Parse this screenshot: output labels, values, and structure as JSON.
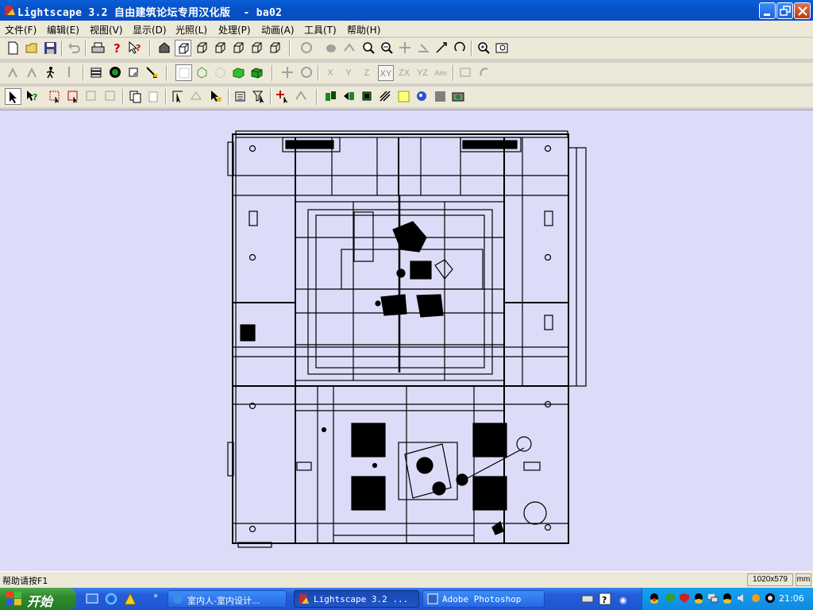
{
  "window": {
    "title": "Lightscape 3.2 自由建筑论坛专用汉化版  - ba02",
    "buttons": [
      "minimize",
      "restore",
      "close"
    ]
  },
  "menu": {
    "items": [
      "文件(F)",
      "编辑(E)",
      "视图(V)",
      "显示(D)",
      "光照(L)",
      "处理(P)",
      "动画(A)",
      "工具(T)",
      "帮助(H)"
    ]
  },
  "toolbar": {
    "axis_labels": [
      "X",
      "Y",
      "Z",
      "XY",
      "ZX",
      "YZ",
      "Aim"
    ]
  },
  "status": {
    "help_text": "帮助请按F1",
    "resolution": "1020x579",
    "units": "mm"
  },
  "taskbar": {
    "start_label": "开始",
    "tasks": [
      {
        "label": "室内人-室内设计..."
      },
      {
        "label": "Lightscape 3.2 ..."
      },
      {
        "label": "Adobe Photoshop"
      }
    ],
    "clock": "21:06"
  },
  "colors": {
    "titlebar": "#0a5fd8",
    "viewport_bg": "#dcdcf8",
    "taskbar": "#245edb",
    "start": "#2e8b2e"
  }
}
